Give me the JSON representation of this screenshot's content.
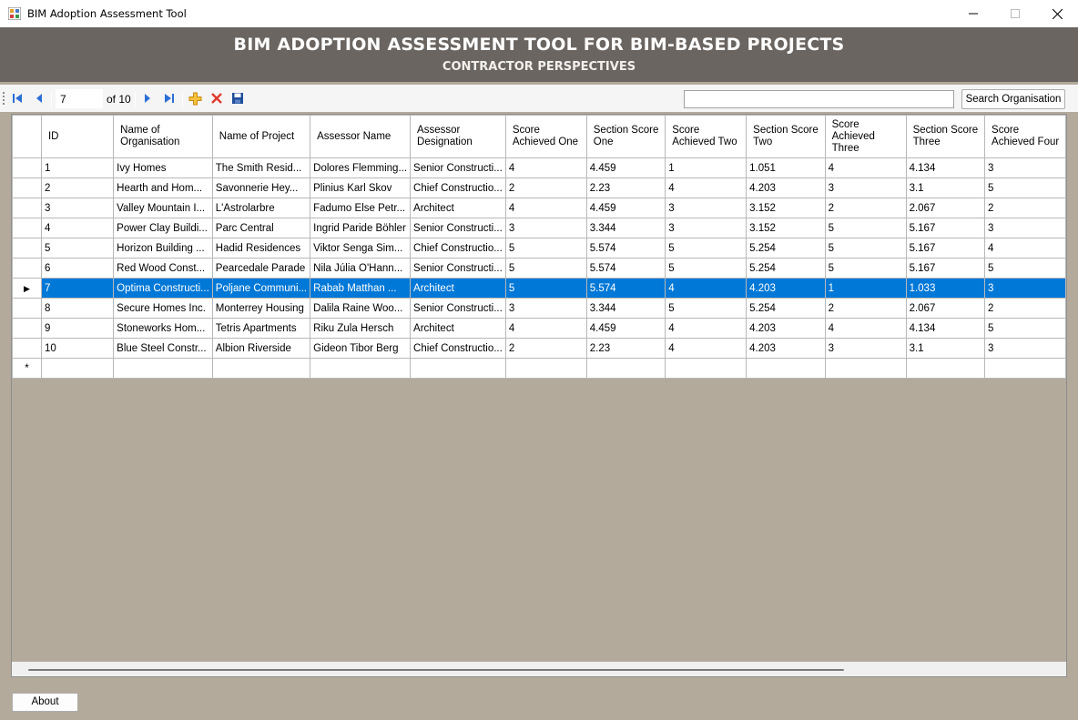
{
  "window": {
    "title": "BIM Adoption Assessment Tool"
  },
  "banner": {
    "title": "BIM ADOPTION ASSESSMENT TOOL FOR BIM-BASED PROJECTS",
    "subtitle": "CONTRACTOR PERSPECTIVES"
  },
  "navigator": {
    "position": "7",
    "count_label": "of 10"
  },
  "search": {
    "value": "",
    "button_label": "Search Organisation"
  },
  "grid": {
    "columns": [
      "ID",
      "Name of Organisation",
      "Name of Project",
      "Assessor Name",
      "Assessor Designation",
      "Score Achieved One",
      "Section Score One",
      "Score Achieved Two",
      "Section Score Two",
      "Score Achieved Three",
      "Section Score Three",
      "Score Achieved Four"
    ],
    "rows": [
      [
        "1",
        "Ivy Homes",
        "The Smith Resid...",
        "Dolores Flemming...",
        "Senior Constructi...",
        "4",
        "4.459",
        "1",
        "1.051",
        "4",
        "4.134",
        "3"
      ],
      [
        "2",
        "Hearth and Hom...",
        "Savonnerie Hey...",
        "Plinius Karl Skov",
        "Chief Constructio...",
        "2",
        "2.23",
        "4",
        "4.203",
        "3",
        "3.1",
        "5"
      ],
      [
        "3",
        "Valley Mountain I...",
        "L'Astrolarbre",
        "Fadumo Else Petr...",
        "Architect",
        "4",
        "4.459",
        "3",
        "3.152",
        "2",
        "2.067",
        "2"
      ],
      [
        "4",
        "Power Clay Buildi...",
        "Parc Central",
        "Ingrid Paride Böhler",
        "Senior Constructi...",
        "3",
        "3.344",
        "3",
        "3.152",
        "5",
        "5.167",
        "3"
      ],
      [
        "5",
        "Horizon Building ...",
        "Hadid Residences",
        "Viktor Senga Sim...",
        "Chief Constructio...",
        "5",
        "5.574",
        "5",
        "5.254",
        "5",
        "5.167",
        "4"
      ],
      [
        "6",
        "Red Wood Const...",
        "Pearcedale Parade",
        "Nila Júlia O'Hann...",
        "Senior Constructi...",
        "5",
        "5.574",
        "5",
        "5.254",
        "5",
        "5.167",
        "5"
      ],
      [
        "7",
        "Optima Constructi...",
        "Poljane Communi...",
        "Rabab Matthan ...",
        "Architect",
        "5",
        "5.574",
        "4",
        "4.203",
        "1",
        "1.033",
        "3"
      ],
      [
        "8",
        "Secure Homes Inc.",
        "Monterrey Housing",
        "Dalila Raine Woo...",
        "Senior Constructi...",
        "3",
        "3.344",
        "5",
        "5.254",
        "2",
        "2.067",
        "2"
      ],
      [
        "9",
        "Stoneworks Hom...",
        "Tetris Apartments",
        "Riku Zula Hersch",
        "Architect",
        "4",
        "4.459",
        "4",
        "4.203",
        "4",
        "4.134",
        "5"
      ],
      [
        "10",
        "Blue Steel Constr...",
        "Albion Riverside",
        "Gideon Tibor Berg",
        "Chief Constructio...",
        "2",
        "2.23",
        "4",
        "4.203",
        "3",
        "3.1",
        "3"
      ]
    ],
    "selected_row": 6,
    "current_marker": "▶",
    "new_row_marker": "*"
  },
  "footer": {
    "about_label": "About"
  },
  "colors": {
    "banner": "#6a6561",
    "selection": "#0078d7",
    "grid_background": "#b3aa9b"
  },
  "icons": [
    "move-first-icon",
    "move-previous-icon",
    "move-next-icon",
    "move-last-icon",
    "add-new-icon",
    "delete-icon",
    "save-icon",
    "minimize-icon",
    "maximize-icon",
    "close-icon"
  ]
}
